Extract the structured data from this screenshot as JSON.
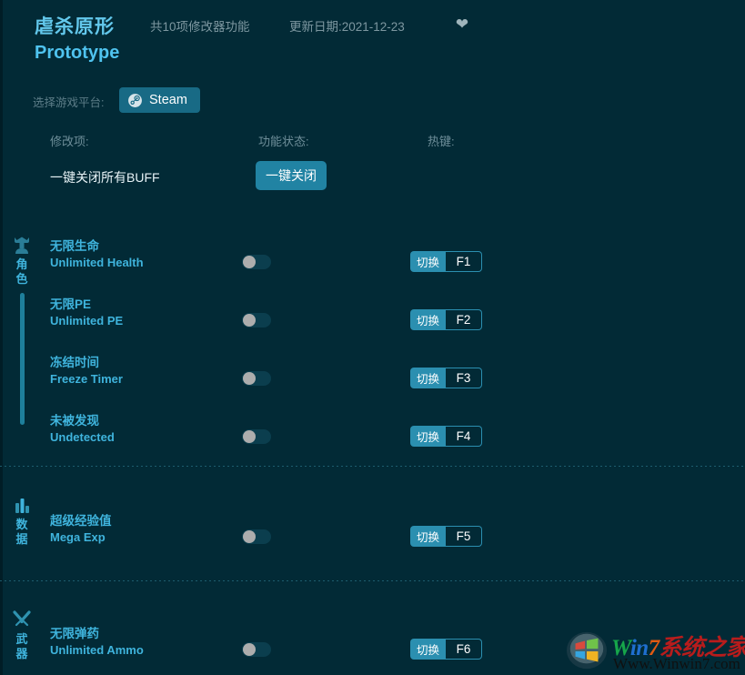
{
  "header": {
    "title_cn": "虐杀原形",
    "title_en": "Prototype",
    "feature_count": "共10项修改器功能",
    "update_date": "更新日期:2021-12-23",
    "favorite_icon": "heart-icon",
    "accent_color": "#3fb4dd",
    "background_color": "#022a36"
  },
  "platform": {
    "label": "选择游戏平台:",
    "selected": "Steam",
    "icon": "steam-icon",
    "button_color": "#186a85"
  },
  "columns": {
    "item": "修改项:",
    "status": "功能状态:",
    "hotkey": "热键:"
  },
  "master": {
    "label": "一键关闭所有BUFF",
    "button_label": "一键关闭",
    "button_color": "#2183a3"
  },
  "categories": [
    {
      "name_cn": "角色",
      "icon": "character-icon",
      "chars": [
        "角",
        "色"
      ]
    },
    {
      "name_cn": "数据",
      "icon": "bar-chart-icon",
      "chars": [
        "数",
        "据"
      ]
    },
    {
      "name_cn": "武器",
      "icon": "crossed-weapons-icon",
      "chars": [
        "武",
        "器"
      ]
    }
  ],
  "cheats": [
    {
      "cn": "无限生命",
      "en": "Unlimited Health",
      "state": "off",
      "action": "切换",
      "key": "F1"
    },
    {
      "cn": "无限PE",
      "en": "Unlimited PE",
      "state": "off",
      "action": "切换",
      "key": "F2"
    },
    {
      "cn": "冻结时间",
      "en": "Freeze Timer",
      "state": "off",
      "action": "切换",
      "key": "F3"
    },
    {
      "cn": "未被发现",
      "en": "Undetected",
      "state": "off",
      "action": "切换",
      "key": "F4"
    },
    {
      "cn": "超级经验值",
      "en": "Mega Exp",
      "state": "off",
      "action": "切换",
      "key": "F5"
    },
    {
      "cn": "无限弹药",
      "en": "Unlimited Ammo",
      "state": "off",
      "action": "切换",
      "key": "F6"
    }
  ],
  "watermark": {
    "brand_w": "W",
    "brand_in": "in",
    "brand_7": "7",
    "brand_cn": "系统之家",
    "url": "Www.Winwin7.com",
    "logo_icon": "windows-logo-icon"
  }
}
